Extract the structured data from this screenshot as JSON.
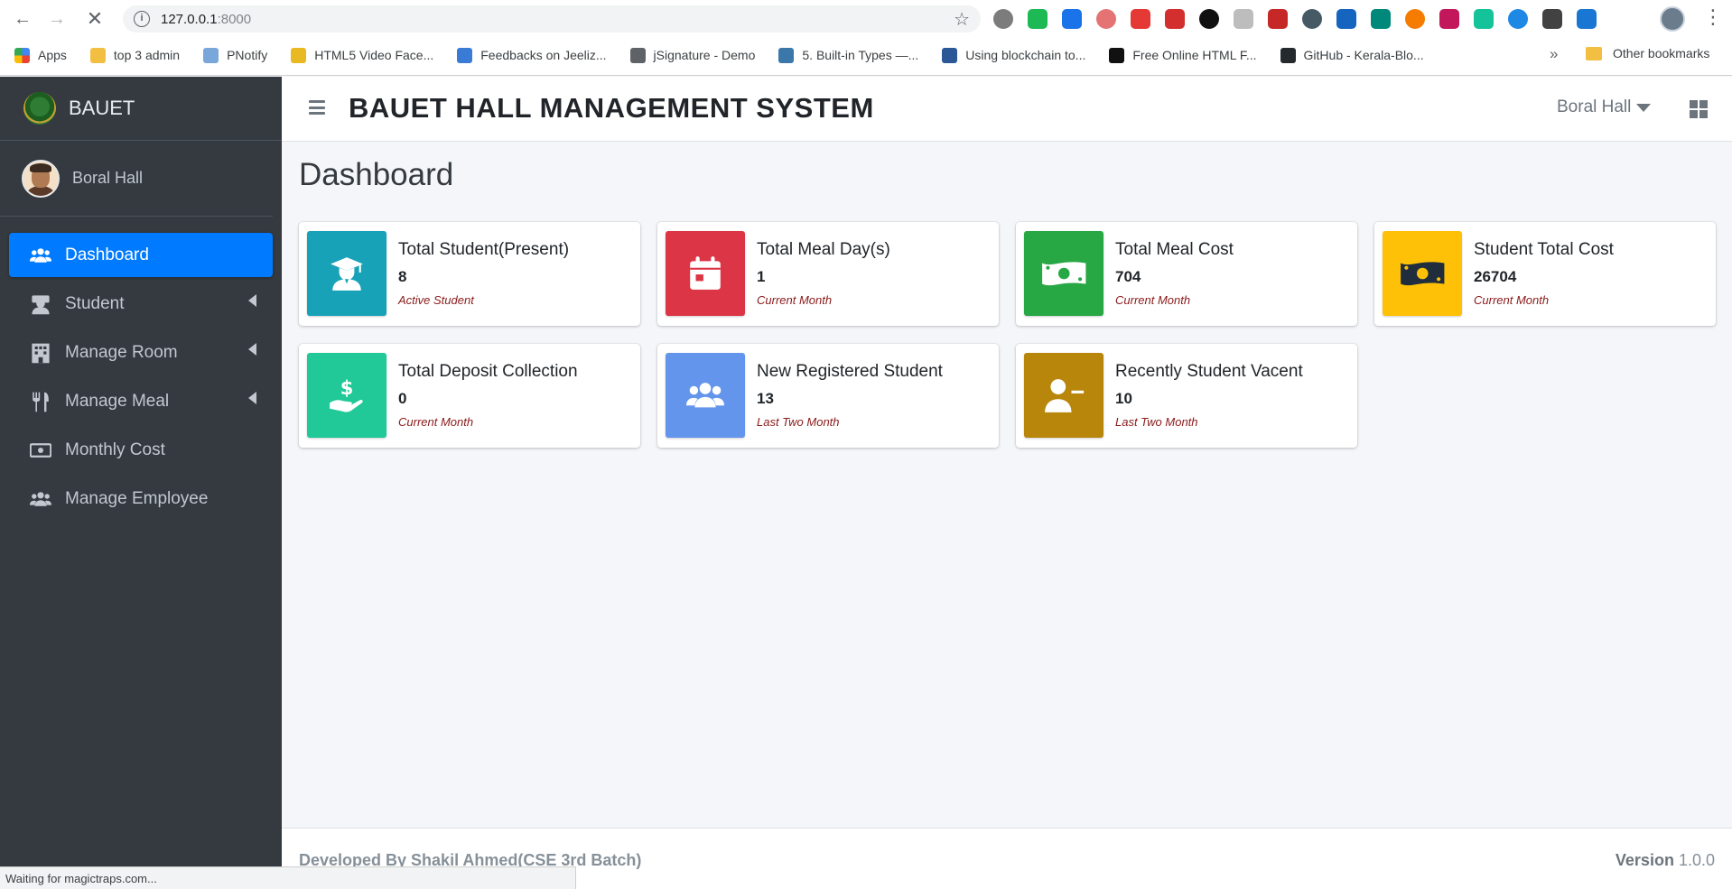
{
  "browser": {
    "url_host": "127.0.0.1",
    "url_port": ":8000",
    "bookmarks": [
      {
        "label": "Apps",
        "color": "#4285f4"
      },
      {
        "label": "top 3 admin",
        "color": "#f2bf42"
      },
      {
        "label": "PNotify",
        "color": "#7aa7d9"
      },
      {
        "label": "HTML5 Video Face...",
        "color": "#e8b923"
      },
      {
        "label": "Feedbacks on Jeeliz...",
        "color": "#3a7bd5"
      },
      {
        "label": "jSignature - Demo",
        "color": "#5f6368"
      },
      {
        "label": "5. Built-in Types —...",
        "color": "#3b77a8"
      },
      {
        "label": "Using blockchain to...",
        "color": "#2b5797"
      },
      {
        "label": "Free Online HTML F...",
        "color": "#111111"
      },
      {
        "label": "GitHub - Kerala-Blo...",
        "color": "#24292e"
      }
    ],
    "more": "»",
    "other_bookmarks": "Other bookmarks",
    "status_text": "Waiting for magictraps.com...",
    "extension_colors": [
      "#7c7c7c",
      "#1db954",
      "#1a73e8",
      "#e57373",
      "#e53935",
      "#d32f2f",
      "#111111",
      "#bdbdbd",
      "#c62828",
      "#455a64",
      "#1565c0",
      "#00897b",
      "#f57c00",
      "#c2185b",
      "#15c39a",
      "#1e88e5",
      "#424242",
      "#1976d2"
    ]
  },
  "sidebar": {
    "brand": "BAUET",
    "user": "Boral Hall",
    "items": [
      {
        "label": "Dashboard",
        "icon": "users-icon",
        "active": true,
        "has_children": false
      },
      {
        "label": "Student",
        "icon": "student-icon",
        "active": false,
        "has_children": true
      },
      {
        "label": "Manage Room",
        "icon": "building-icon",
        "active": false,
        "has_children": true
      },
      {
        "label": "Manage Meal",
        "icon": "utensils-icon",
        "active": false,
        "has_children": true
      },
      {
        "label": "Monthly Cost",
        "icon": "money-icon",
        "active": false,
        "has_children": false
      },
      {
        "label": "Manage Employee",
        "icon": "users-icon",
        "active": false,
        "has_children": false
      }
    ]
  },
  "header": {
    "title": "BAUET HALL MANAGEMENT SYSTEM",
    "hall": "Boral Hall"
  },
  "page": {
    "title": "Dashboard"
  },
  "boxes": [
    {
      "label": "Total Student(Present)",
      "value": "8",
      "sub": "Active Student",
      "color": "#17a2b8",
      "icon": "graduate-icon"
    },
    {
      "label": "Total Meal Day(s)",
      "value": "1",
      "sub": "Current Month",
      "color": "#dc3545",
      "icon": "calendar-icon"
    },
    {
      "label": "Total Meal Cost",
      "value": "704",
      "sub": "Current Month",
      "color": "#28a745",
      "icon": "money-bill-icon"
    },
    {
      "label": "Student Total Cost",
      "value": "26704",
      "sub": "Current Month",
      "color": "#ffc107",
      "icon": "money-bill-icon"
    },
    {
      "label": "Total Deposit Collection",
      "value": "0",
      "sub": "Current Month",
      "color": "#20c997",
      "icon": "hand-dollar-icon"
    },
    {
      "label": "New Registered Student",
      "value": "13",
      "sub": "Last Two Month",
      "color": "#6495ed",
      "icon": "users-icon"
    },
    {
      "label": "Recently Student Vacent",
      "value": "10",
      "sub": "Last Two Month",
      "color": "#b8860b",
      "icon": "user-minus-icon"
    }
  ],
  "footer": {
    "credit": "Developed By Shakil Ahmed(CSE 3rd Batch)",
    "version_label": "Version",
    "version": "1.0.0"
  }
}
